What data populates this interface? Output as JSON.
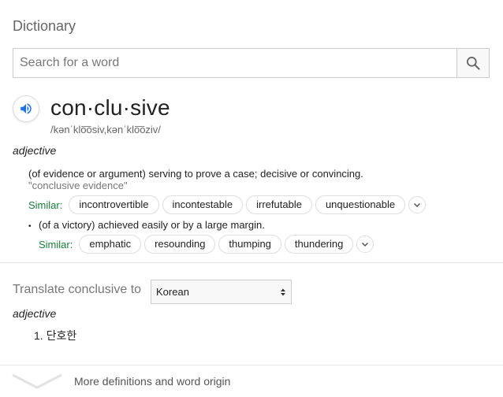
{
  "header": {
    "title": "Dictionary"
  },
  "search": {
    "placeholder": "Search for a word",
    "value": ""
  },
  "entry": {
    "headword": "con·clu·sive",
    "phonetic": "/kənˈklo͞osiv,kənˈklo͞oziv/",
    "part_of_speech": "adjective",
    "senses": [
      {
        "definition": "(of evidence or argument) serving to prove a case; decisive or convincing.",
        "example": "\"conclusive evidence\"",
        "similar_label": "Similar:",
        "similar": [
          "incontrovertible",
          "incontestable",
          "irrefutable",
          "unquestionable"
        ]
      },
      {
        "bullet": "•",
        "definition": "(of a victory) achieved easily or by a large margin.",
        "similar_label": "Similar:",
        "similar": [
          "emphatic",
          "resounding",
          "thumping",
          "thundering"
        ]
      }
    ]
  },
  "translate": {
    "label": "Translate conclusive to",
    "language": "Korean",
    "part_of_speech": "adjective",
    "items": [
      {
        "number": "1.",
        "text": "단호한"
      }
    ]
  },
  "footer": {
    "more_label": "More definitions and word origin"
  },
  "colors": {
    "similar_label": "#188038",
    "speaker_icon": "#1a73e8"
  }
}
